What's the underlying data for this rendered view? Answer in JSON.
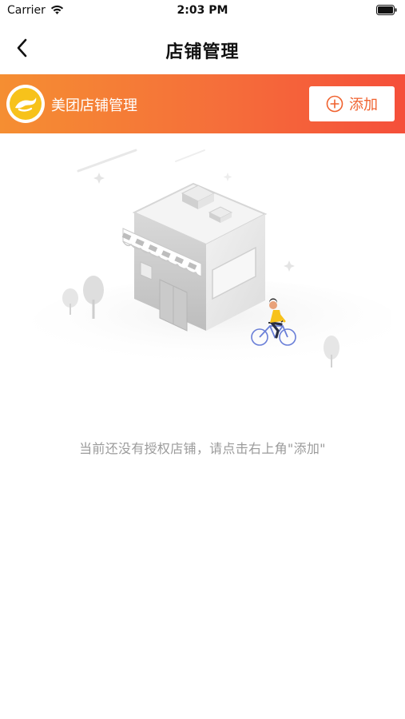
{
  "status_bar": {
    "carrier": "Carrier",
    "time": "2:03 PM",
    "icons": [
      "wifi-icon",
      "battery-icon"
    ]
  },
  "nav": {
    "back_icon": "chevron-left-icon",
    "title": "店铺管理"
  },
  "banner": {
    "logo_icon": "meituan-kangaroo-logo",
    "brand_name": "美团店铺管理",
    "add_button": {
      "icon": "plus-circle-icon",
      "label": "添加"
    }
  },
  "empty_state": {
    "illustration": "shop-building-with-cyclist",
    "message": "当前还没有授权店铺，请点击右上角\"添加\""
  },
  "colors": {
    "banner_start": "#f58e32",
    "banner_end": "#f54f3a",
    "accent": "#f0622f",
    "logo_yellow": "#f7c21b",
    "message_gray": "#9b9b9b"
  }
}
